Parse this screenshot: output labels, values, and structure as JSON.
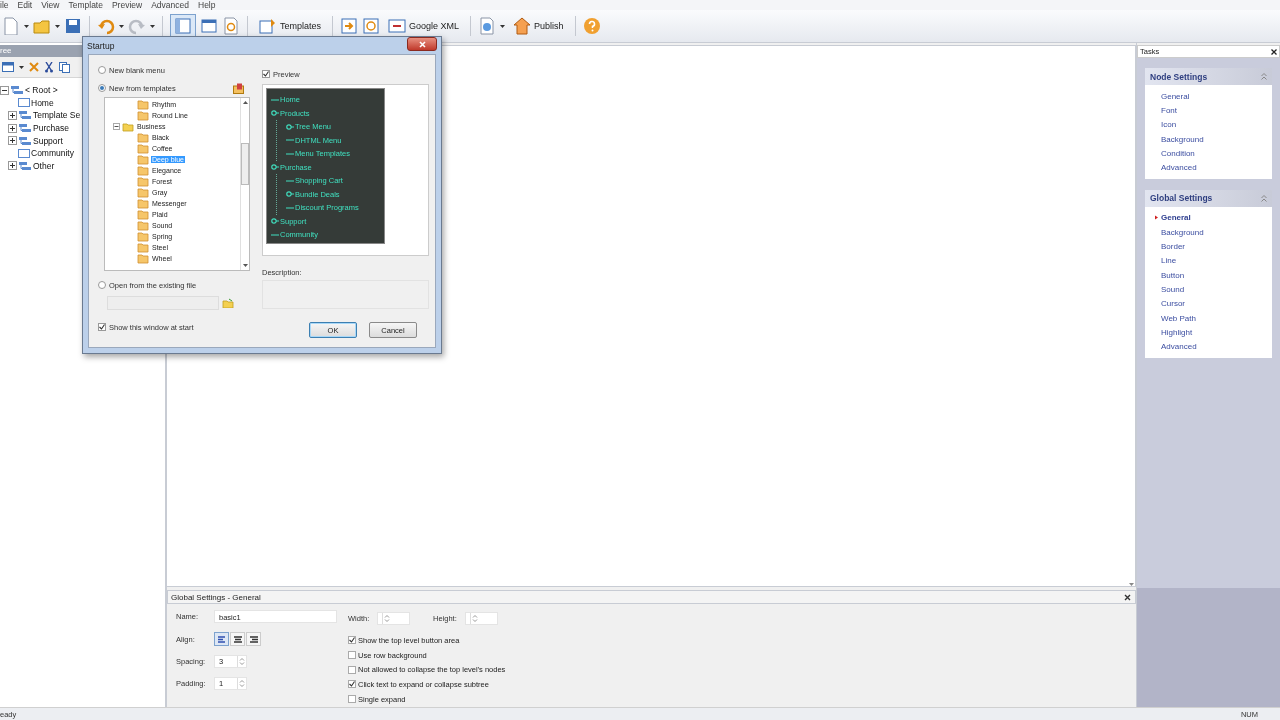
{
  "menu": [
    "ile",
    "Edit",
    "View",
    "Template",
    "Preview",
    "Advanced",
    "Help"
  ],
  "toolbar": {
    "buttons": [
      {
        "label": "Templates",
        "kind": "templates"
      },
      {
        "label": "Google XML",
        "kind": "xml"
      },
      {
        "label": "Publish",
        "kind": "publish"
      }
    ]
  },
  "tree_panel": {
    "title": "ree",
    "items": [
      {
        "label": "< Root >",
        "kind": "folder",
        "expanded": true,
        "children": [
          {
            "label": "Home",
            "kind": "page"
          },
          {
            "label": "Template Se",
            "kind": "folder",
            "expanded": false
          },
          {
            "label": "Purchase",
            "kind": "folder",
            "expanded": false
          },
          {
            "label": "Support",
            "kind": "folder",
            "expanded": false
          },
          {
            "label": "Community",
            "kind": "page"
          },
          {
            "label": "Other",
            "kind": "folder",
            "expanded": false
          }
        ]
      }
    ]
  },
  "dialog": {
    "title": "Startup",
    "sources": [
      {
        "label": "New blank menu",
        "selected": false
      },
      {
        "label": "New from templates",
        "selected": true
      },
      {
        "label": "Open from the existing file",
        "selected": false
      }
    ],
    "templates": [
      {
        "label": "Rhythm",
        "kind": "template",
        "selected": false
      },
      {
        "label": "Round Line",
        "kind": "template",
        "selected": false
      },
      {
        "label": "Business",
        "kind": "category",
        "expanded": true,
        "selected": false,
        "children": [
          {
            "label": "Black",
            "selected": false
          },
          {
            "label": "Coffee",
            "selected": false
          },
          {
            "label": "Deep blue",
            "selected": true
          },
          {
            "label": "Elegance",
            "selected": false
          },
          {
            "label": "Forest",
            "selected": false
          },
          {
            "label": "Gray",
            "selected": false
          },
          {
            "label": "Messenger",
            "selected": false
          },
          {
            "label": "Plaid",
            "selected": false
          },
          {
            "label": "Sound",
            "selected": false
          },
          {
            "label": "Spring",
            "selected": false
          },
          {
            "label": "Steel",
            "selected": false
          },
          {
            "label": "Wheel",
            "selected": false
          }
        ]
      }
    ],
    "preview": {
      "label": "Preview",
      "checked": true,
      "menu": [
        {
          "label": "Home",
          "kind": "page"
        },
        {
          "label": "Products",
          "kind": "folder",
          "children": [
            {
              "label": "Tree Menu",
              "kind": "folder"
            },
            {
              "label": "DHTML Menu",
              "kind": "page"
            },
            {
              "label": "Menu Templates",
              "kind": "page"
            }
          ]
        },
        {
          "label": "Purchase",
          "kind": "folder",
          "children": [
            {
              "label": "Shopping Cart",
              "kind": "page"
            },
            {
              "label": "Bundle Deals",
              "kind": "folder"
            },
            {
              "label": "Discount Programs",
              "kind": "page"
            }
          ]
        },
        {
          "label": "Support",
          "kind": "folder"
        },
        {
          "label": "Community",
          "kind": "page"
        }
      ]
    },
    "description_label": "Description:",
    "show_at_start": {
      "label": "Show this window at start",
      "checked": true
    },
    "buttons": [
      {
        "label": "OK",
        "default": true
      },
      {
        "label": "Cancel",
        "default": false
      }
    ]
  },
  "tasks": {
    "title": "Tasks",
    "sections": [
      {
        "title": "Node Settings",
        "expanded": true,
        "items": [
          {
            "label": "General",
            "selected": false
          },
          {
            "label": "Font",
            "selected": false
          },
          {
            "label": "Icon",
            "selected": false
          },
          {
            "label": "Background",
            "selected": false
          },
          {
            "label": "Condition",
            "selected": false
          },
          {
            "label": "Advanced",
            "selected": false
          }
        ]
      },
      {
        "title": "Global Settings",
        "expanded": true,
        "items": [
          {
            "label": "General",
            "selected": true
          },
          {
            "label": "Background",
            "selected": false
          },
          {
            "label": "Border",
            "selected": false
          },
          {
            "label": "Line",
            "selected": false
          },
          {
            "label": "Button",
            "selected": false
          },
          {
            "label": "Sound",
            "selected": false
          },
          {
            "label": "Cursor",
            "selected": false
          },
          {
            "label": "Web Path",
            "selected": false
          },
          {
            "label": "Highlight",
            "selected": false
          },
          {
            "label": "Advanced",
            "selected": false
          }
        ]
      }
    ]
  },
  "settings": {
    "title": "Global Settings - General",
    "name": {
      "label": "Name:",
      "value": "basic1"
    },
    "width": {
      "label": "Width:"
    },
    "height": {
      "label": "Height:"
    },
    "align": {
      "label": "Align:",
      "options": [
        {
          "kind": "left",
          "selected": true
        },
        {
          "kind": "center",
          "selected": false
        },
        {
          "kind": "right",
          "selected": false
        }
      ]
    },
    "spacing": {
      "label": "Spacing:",
      "value": "3"
    },
    "padding": {
      "label": "Padding:",
      "value": "1"
    },
    "options": [
      {
        "label": "Show the top level button area",
        "checked": true
      },
      {
        "label": "Use row background",
        "checked": false
      },
      {
        "label": "Not allowed to collapse the top level's nodes",
        "checked": false
      },
      {
        "label": "Click text to expand or collapse subtree",
        "checked": true
      },
      {
        "label": "Single expand",
        "checked": false
      }
    ]
  },
  "status_bar": {
    "message": "eady",
    "indicators": [
      "NUM"
    ]
  }
}
